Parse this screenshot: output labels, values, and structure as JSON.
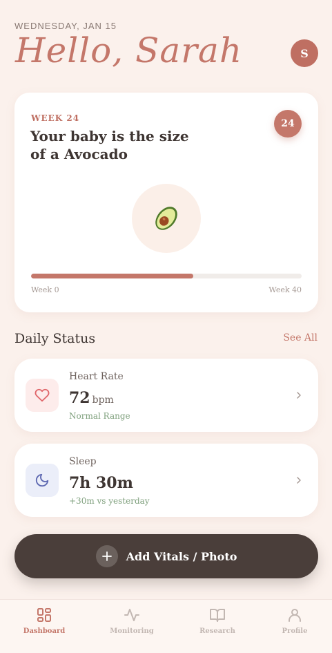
{
  "header": {
    "date": "WEDNESDAY, JAN 15",
    "greeting": "Hello, Sarah",
    "avatar_initial": "S"
  },
  "pregnancy_card": {
    "week_label": "WEEK 24",
    "size_text": "Your baby is the size of a Avocado",
    "week_badge": "24",
    "fruit_icon": "avocado-icon",
    "progress_percent": 60,
    "progress_start_label": "Week 0",
    "progress_end_label": "Week 40"
  },
  "daily_status": {
    "title": "Daily Status",
    "see_all": "See All",
    "items": [
      {
        "icon": "heart-icon",
        "label": "Heart Rate",
        "value": "72",
        "unit": "bpm",
        "sub": "Normal Range"
      },
      {
        "icon": "moon-icon",
        "label": "Sleep",
        "value": "7h 30m",
        "unit": "",
        "sub": "+30m vs yesterday"
      }
    ]
  },
  "add_button": {
    "label": "Add Vitals / Photo",
    "icon": "plus-icon"
  },
  "nav": {
    "items": [
      {
        "label": "Dashboard",
        "icon": "grid-icon",
        "active": true
      },
      {
        "label": "Monitoring",
        "icon": "activity-icon",
        "active": false
      },
      {
        "label": "Research",
        "icon": "book-icon",
        "active": false
      },
      {
        "label": "Profile",
        "icon": "user-icon",
        "active": false
      }
    ]
  },
  "colors": {
    "background": "#fbf1ec",
    "accent": "#c4776a",
    "dark": "#4a3e3a",
    "success": "#7fa07d",
    "heart": "#e0666a",
    "moon": "#5b66b0"
  }
}
